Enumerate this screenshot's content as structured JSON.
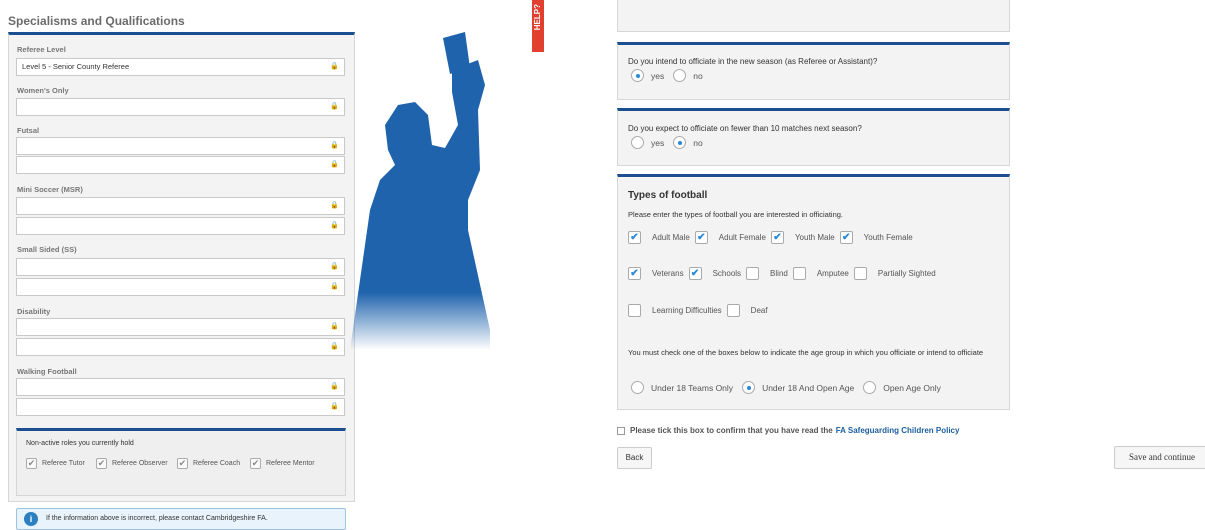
{
  "section_title": "Specialisms and Qualifications",
  "left": {
    "referee_level_label": "Referee Level",
    "referee_level_value": "Level 5 - Senior County Referee",
    "womens_only_label": "Women's Only",
    "futsal_label": "Futsal",
    "mini_soccer_label": "Mini Soccer (MSR)",
    "small_sided_label": "Small Sided (SS)",
    "disability_label": "Disability",
    "walking_label": "Walking Football",
    "lock_glyph": "🔒",
    "nonactive_title": "Non-active roles you currently hold",
    "roles": [
      "Referee Tutor",
      "Referee Observer",
      "Referee Coach",
      "Referee Mentor"
    ],
    "info_text": "If the information above is incorrect, please contact Cambridgeshire FA."
  },
  "help_tab": "HELP?",
  "q1": {
    "text": "Do you intend to officiate in the new season (as Referee or Assistant)?",
    "yes": "yes",
    "no": "no",
    "selected": "yes"
  },
  "q2": {
    "text": "Do you expect to officiate on fewer than 10 matches next season?",
    "yes": "yes",
    "no": "no",
    "selected": "no"
  },
  "types": {
    "title": "Types of football",
    "description": "Please enter the types of football you are interested in officiating.",
    "options": [
      {
        "label": "Adult Male",
        "checked": true
      },
      {
        "label": "Adult Female",
        "checked": true
      },
      {
        "label": "Youth Male",
        "checked": true
      },
      {
        "label": "Youth Female",
        "checked": true
      },
      {
        "label": "Veterans",
        "checked": true
      },
      {
        "label": "Schools",
        "checked": true
      },
      {
        "label": "Blind",
        "checked": false
      },
      {
        "label": "Amputee",
        "checked": false
      },
      {
        "label": "Partially Sighted",
        "checked": false
      },
      {
        "label": "Learning Difficulties",
        "checked": false
      },
      {
        "label": "Deaf",
        "checked": false
      }
    ],
    "age_text": "You must check one of the boxes below to indicate the age group in which you officiate or intend to officiate",
    "age_options": [
      "Under 18 Teams Only",
      "Under 18 And Open Age",
      "Open Age Only"
    ],
    "age_selected": "Under 18 And Open Age"
  },
  "confirm": {
    "text": "Please tick this box to confirm that you have read the",
    "link": "FA Safeguarding Children Policy"
  },
  "buttons": {
    "back": "Back",
    "save": "Save and continue"
  },
  "colors": {
    "accent": "#1b4f8f",
    "radio": "#2a88d8",
    "help": "#e2402f",
    "silhouette": "#1f63ad"
  }
}
